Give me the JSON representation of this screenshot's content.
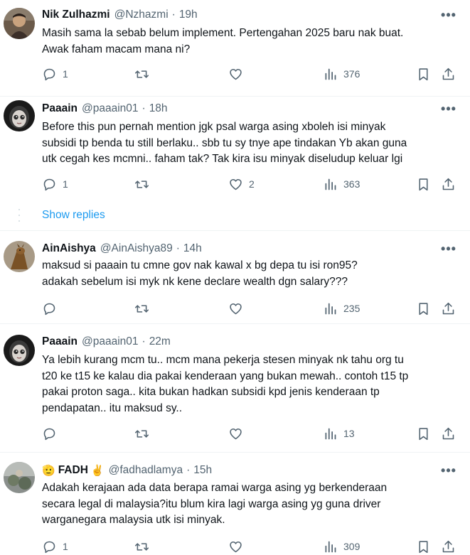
{
  "tweets": [
    {
      "name": "Nik Zulhazmi",
      "handle": "@Nzhazmi",
      "time": "19h",
      "lines": [
        "Masih sama la sebab belum implement. Pertengahan 2025 baru nak buat.",
        "Awak faham macam mana ni?"
      ],
      "replies": "1",
      "reposts": "",
      "likes": "",
      "views": "376"
    },
    {
      "name": "Paaain",
      "handle": "@paaain01",
      "time": "18h",
      "lines": [
        "Before this pun pernah mention jgk psal warga asing xboleh isi minyak",
        "subsidi tp benda tu still berlaku.. sbb tu sy tnye ape tindakan Yb akan guna",
        "utk cegah kes mcmni.. faham tak? Tak kira isu minyak diseludup keluar lgi"
      ],
      "replies": "1",
      "reposts": "",
      "likes": "2",
      "views": "363"
    },
    {
      "name": "AinAishya",
      "handle": "@AinAishya89",
      "time": "14h",
      "lines": [
        "maksud si paaain tu cmne  gov nak kawal x bg depa tu isi ron95?",
        "adakah sebelum isi myk nk kene declare wealth dgn salary???"
      ],
      "replies": "",
      "reposts": "",
      "likes": "",
      "views": "235"
    },
    {
      "name": "Paaain",
      "handle": "@paaain01",
      "time": "22m",
      "lines": [
        "Ya lebih kurang mcm tu.. mcm mana pekerja stesen minyak nk tahu org tu",
        "t20 ke t15 ke kalau dia pakai kenderaan yang bukan mewah.. contoh t15 tp",
        "pakai proton saga.. kita bukan hadkan subsidi kpd jenis kenderaan tp",
        "pendapatan.. itu maksud sy.."
      ],
      "replies": "",
      "reposts": "",
      "likes": "",
      "views": "13"
    },
    {
      "name": "FADH",
      "handle": "@fadhadlamya",
      "time": "15h",
      "lines": [
        "Adakah kerajaan ada data berapa ramai warga asing yg berkenderaan",
        "secara legal di malaysia?itu blum kira lagi warga asing yg guna driver",
        "warganegara malaysia utk isi minyak."
      ],
      "replies": "1",
      "reposts": "",
      "likes": "",
      "views": "309"
    }
  ],
  "show_replies": "Show replies",
  "dot": "·",
  "more_glyph": "•••",
  "icons": {
    "reply": "reply-icon",
    "repost": "repost-icon",
    "like": "like-icon",
    "views": "views-icon",
    "bookmark": "bookmark-icon",
    "share": "share-icon",
    "more": "more-icon"
  },
  "emoji_left": "🫡",
  "emoji_right": "✌️",
  "colors": {
    "text": "#0f1419",
    "muted": "#536471",
    "link": "#1d9bf0",
    "divider": "#eff3f4"
  }
}
